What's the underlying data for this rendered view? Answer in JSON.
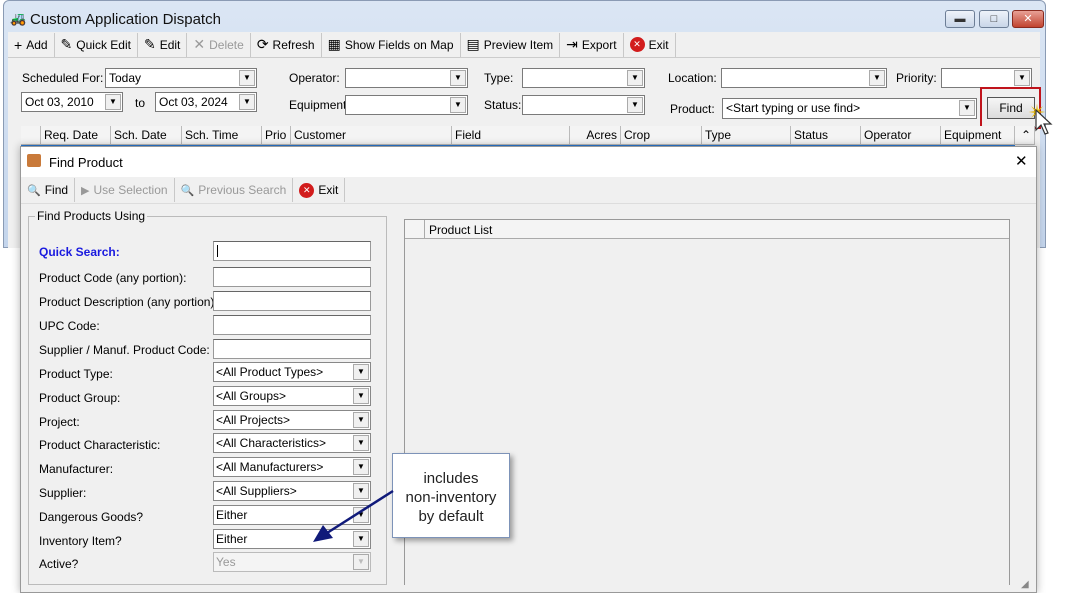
{
  "window": {
    "title": "Custom Application Dispatch",
    "min": "▬",
    "max": "□",
    "close": "✕"
  },
  "toolbar": [
    {
      "label": "Add",
      "icon": "plus-icon",
      "glyph": "+"
    },
    {
      "label": "Quick Edit",
      "icon": "pencil-icon",
      "glyph": "✎"
    },
    {
      "label": "Edit",
      "icon": "pencil-icon",
      "glyph": "✎"
    },
    {
      "label": "Delete",
      "icon": "x-icon",
      "glyph": "✕",
      "disabled": true
    },
    {
      "label": "Refresh",
      "icon": "refresh-icon",
      "glyph": "⟳"
    },
    {
      "label": "Show Fields on Map",
      "icon": "map-icon",
      "glyph": "▦"
    },
    {
      "label": "Preview Item",
      "icon": "preview-icon",
      "glyph": "▤"
    },
    {
      "label": "Export",
      "icon": "excel-export-icon",
      "glyph": "⇥"
    },
    {
      "label": "Exit",
      "icon": "exit-icon",
      "glyph": "✕"
    }
  ],
  "filters": {
    "scheduled_for_label": "Scheduled For:",
    "scheduled_for": "Today",
    "date_from": "Oct  03, 2010",
    "to_label": "to",
    "date_to": "Oct  03, 2024",
    "operator_label": "Operator:",
    "operator": "",
    "equipment_label": "Equipment:",
    "equipment": "",
    "type_label": "Type:",
    "type": "",
    "status_label": "Status:",
    "status": "",
    "location_label": "Location:",
    "location": "",
    "priority_label": "Priority:",
    "priority": "",
    "product_label": "Product:",
    "product_placeholder": "<Start typing or use find>",
    "find_button": "Find"
  },
  "grid": {
    "columns": [
      "Req. Date",
      "Sch. Date",
      "Sch. Time",
      "Prio",
      "Customer",
      "Field",
      "Acres",
      "Crop",
      "Type",
      "Status",
      "Operator",
      "Equipment"
    ]
  },
  "find_dialog": {
    "title": "Find Product",
    "close": "✕",
    "toolbar": [
      {
        "label": "Find",
        "glyph": "🔍"
      },
      {
        "label": "Use Selection",
        "glyph": "▶",
        "disabled": true
      },
      {
        "label": "Previous Search",
        "glyph": "🔍",
        "disabled": true
      },
      {
        "label": "Exit",
        "glyph": "✕"
      }
    ],
    "group_title": "Find Products Using",
    "quick_search_label": "Quick Search:",
    "text_fields": [
      "Product Code (any portion):",
      "Product Description (any portion):",
      "UPC Code:",
      "Supplier / Manuf. Product Code:"
    ],
    "selects": [
      {
        "label": "Product Type:",
        "value": "<All Product Types>"
      },
      {
        "label": "Product Group:",
        "value": "<All Groups>"
      },
      {
        "label": "Project:",
        "value": "<All Projects>"
      },
      {
        "label": "Product Characteristic:",
        "value": "<All Characteristics>"
      },
      {
        "label": "Manufacturer:",
        "value": "<All Manufacturers>"
      },
      {
        "label": "Supplier:",
        "value": "<All Suppliers>"
      },
      {
        "label": "Dangerous Goods?",
        "value": "Either"
      },
      {
        "label": "Inventory Item?",
        "value": "Either"
      },
      {
        "label": "Active?",
        "value": "Yes",
        "disabled": true
      }
    ],
    "product_list_header": "Product List"
  },
  "callout": {
    "line1": "includes",
    "line2": "non-inventory",
    "line3": "by default"
  }
}
